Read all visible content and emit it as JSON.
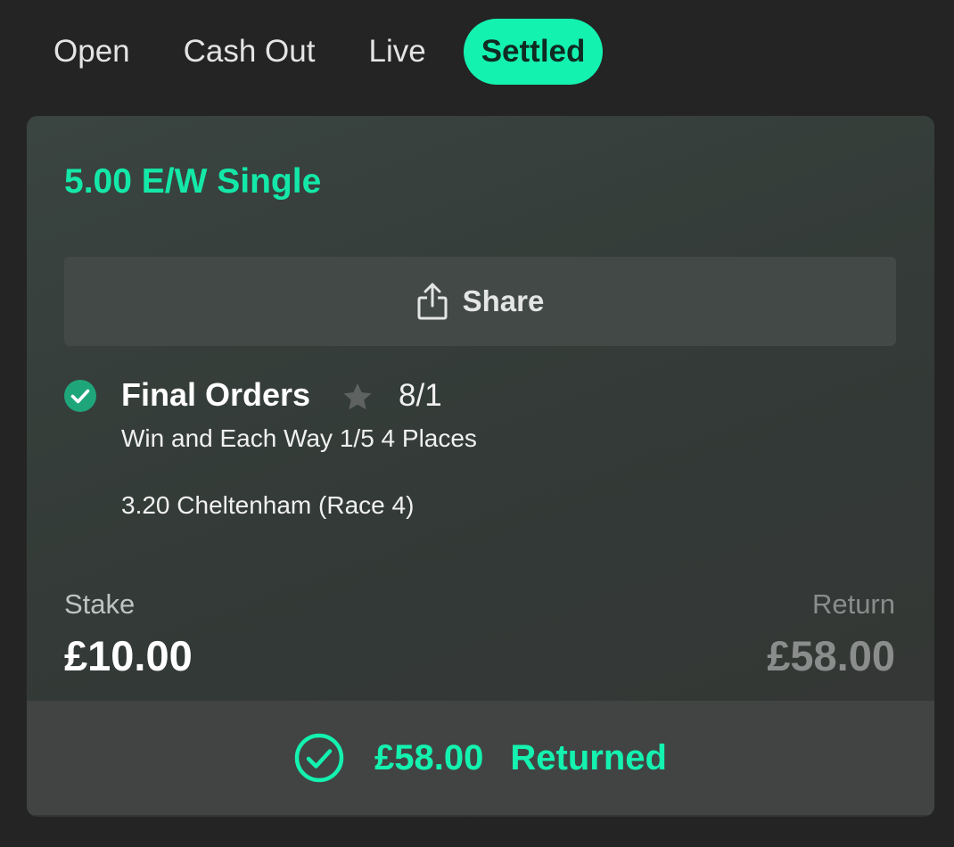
{
  "tabs": [
    {
      "label": "Open"
    },
    {
      "label": "Cash Out"
    },
    {
      "label": "Live"
    },
    {
      "label": "Settled",
      "active": true
    }
  ],
  "bet": {
    "title": "5.00 E/W Single",
    "share_label": "Share",
    "selection": {
      "name": "Final Orders",
      "odds": "8/1",
      "market": "Win and Each Way 1/5 4 Places",
      "event": "3.20 Cheltenham (Race 4)",
      "status_icon": "check-circle-icon",
      "favourite_icon": "star-icon"
    },
    "stake_label": "Stake",
    "stake_value": "£10.00",
    "return_label": "Return",
    "return_value": "£58.00",
    "result": {
      "amount": "£58.00",
      "status": "Returned"
    }
  },
  "colors": {
    "accent": "#14f2b0",
    "background": "#242424",
    "card": "#373d3a",
    "muted": "#8a8d8c"
  }
}
